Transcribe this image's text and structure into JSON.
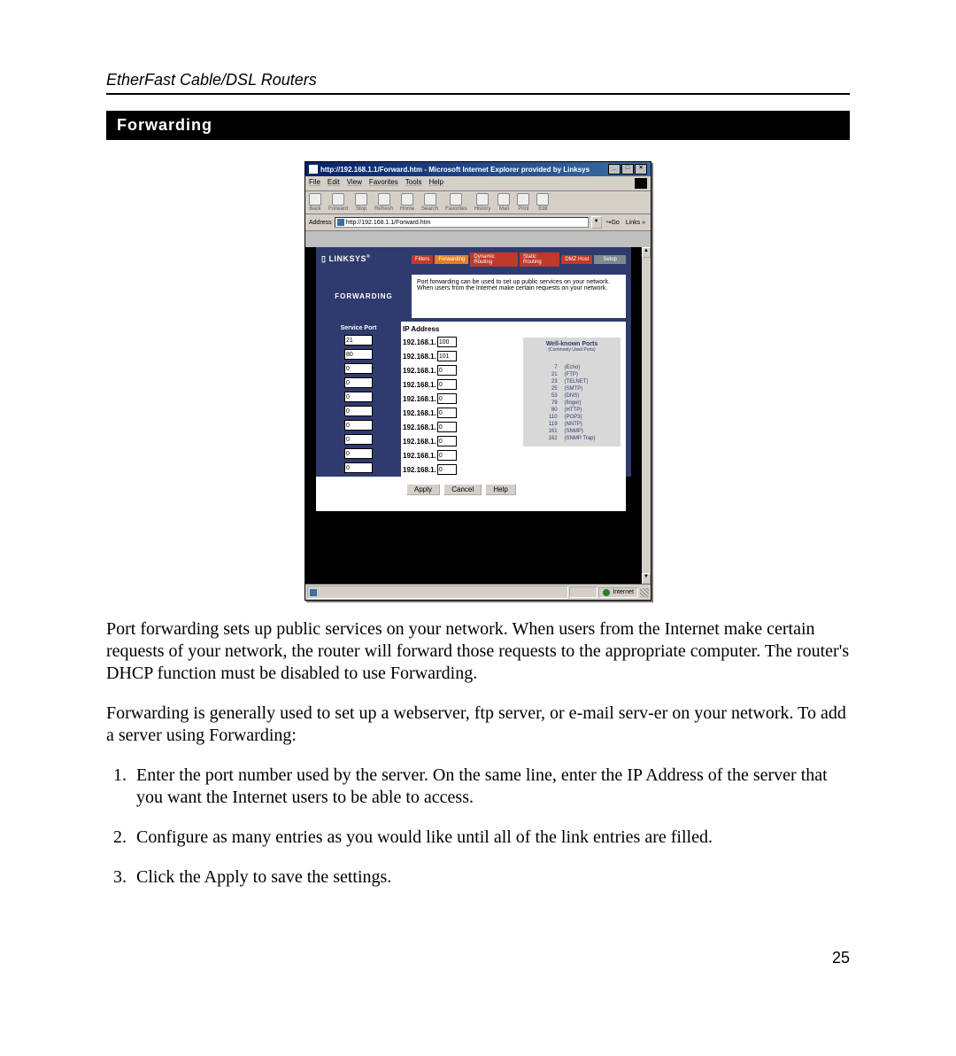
{
  "doc": {
    "header": "EtherFast Cable/DSL Routers",
    "section_title": "Forwarding",
    "page_number": "25",
    "para1": "Port forwarding sets up public services on your network. When users from the Internet make certain requests of your network, the router will forward those requests to the appropriate computer. The router's DHCP function must be disabled to use Forwarding.",
    "para2": "Forwarding is generally used to set up a webserver, ftp server, or e-mail serv-er on your network. To add a server using Forwarding:",
    "steps": [
      "Enter the port number used by the server. On the same line, enter the IP Address of the server that you want the Internet users to be able to access.",
      "Configure as many entries as you would like until all of the link entries are filled.",
      "Click the Apply to save the settings."
    ]
  },
  "browser": {
    "title": "http://192.168.1.1/Forward.htm - Microsoft Internet Explorer provided by Linksys",
    "menus": [
      "File",
      "Edit",
      "View",
      "Favorites",
      "Tools",
      "Help"
    ],
    "toolbar": [
      "Back",
      "Forward",
      "Stop",
      "Refresh",
      "Home",
      "Search",
      "Favorites",
      "History",
      "Mail",
      "Print",
      "Edit"
    ],
    "address_label": "Address",
    "address_value": "http://192.168.1.1/Forward.htm",
    "go_label": "Go",
    "links_label": "Links",
    "status_zone": "Internet"
  },
  "router": {
    "brand": "LINKSYS",
    "tabs": [
      "Filters",
      "Forwarding",
      "Dynamic Routing",
      "Static Routing",
      "DMZ Host"
    ],
    "setup_tab": "Setup",
    "side_label": "FORWARDING",
    "description": "Port forwarding can be used to set up public services on your network. When users from the Internet make certain requests on your network.",
    "service_port_header": "Service Port",
    "ip_header": "IP Address",
    "ip_prefix": "192.168.1.",
    "entries": [
      {
        "port": "21",
        "ip_last": "100"
      },
      {
        "port": "80",
        "ip_last": "101"
      },
      {
        "port": "0",
        "ip_last": "0"
      },
      {
        "port": "0",
        "ip_last": "0"
      },
      {
        "port": "0",
        "ip_last": "0"
      },
      {
        "port": "0",
        "ip_last": "0"
      },
      {
        "port": "0",
        "ip_last": "0"
      },
      {
        "port": "0",
        "ip_last": "0"
      },
      {
        "port": "0",
        "ip_last": "0"
      },
      {
        "port": "0",
        "ip_last": "0"
      }
    ],
    "wellknown": {
      "title": "Well-known Ports",
      "subtitle": "(Commonly Used Ports)",
      "rows": [
        {
          "port": "7",
          "name": "(Echo)"
        },
        {
          "port": "21",
          "name": "(FTP)"
        },
        {
          "port": "23",
          "name": "(TELNET)"
        },
        {
          "port": "25",
          "name": "(SMTP)"
        },
        {
          "port": "53",
          "name": "(DNS)"
        },
        {
          "port": "79",
          "name": "(finger)"
        },
        {
          "port": "80",
          "name": "(HTTP)"
        },
        {
          "port": "110",
          "name": "(POP3)"
        },
        {
          "port": "119",
          "name": "(NNTP)"
        },
        {
          "port": "161",
          "name": "(SNMP)"
        },
        {
          "port": "162",
          "name": "(SNMP Trap)"
        }
      ]
    },
    "buttons": {
      "apply": "Apply",
      "cancel": "Cancel",
      "help": "Help"
    }
  }
}
